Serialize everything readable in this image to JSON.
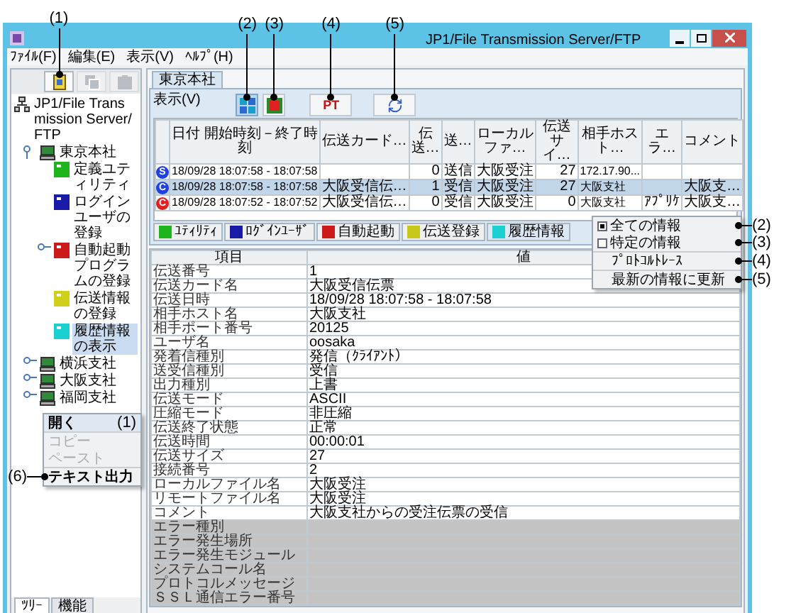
{
  "window": {
    "title": "JP1/File Transmission Server/FTP"
  },
  "menu_bar": [
    "ﾌｧｲﾙ(F)",
    "編集(E)",
    "表示(V)",
    "ﾍﾙﾌﾟ(H)"
  ],
  "left_toolbar": [
    {
      "kind": "book",
      "disabled": false,
      "callout": "(1)"
    },
    {
      "kind": "copy",
      "disabled": true
    },
    {
      "kind": "paste",
      "disabled": true
    }
  ],
  "tree": {
    "label": "JP1/File Transmission Server/FTP",
    "kind": "root",
    "children": [
      {
        "label": "東京本社",
        "kind": "host",
        "expanded": true,
        "selected": false,
        "children": [
          {
            "label": "定義ユティリティ",
            "kind": "function",
            "color": "#1fb51f",
            "selected": false
          },
          {
            "label": "ログインユーザの登録",
            "kind": "function",
            "color": "#1a1aa8",
            "selected": false
          },
          {
            "label": "自動起動プログラムの登録",
            "kind": "function",
            "color": "#cc1a1a",
            "expanded": false,
            "selected": false
          },
          {
            "label": "伝送情報の登録",
            "kind": "function",
            "color": "#d0d01a",
            "selected": false
          },
          {
            "label": "履歴情報の表示",
            "kind": "function",
            "color": "#1ad0d0",
            "selected": true
          }
        ]
      },
      {
        "label": "横浜支社",
        "kind": "host",
        "expanded": false,
        "selected": false
      },
      {
        "label": "大阪支社",
        "kind": "host",
        "expanded": false,
        "selected": false
      },
      {
        "label": "福岡支社",
        "kind": "host",
        "expanded": false,
        "selected": false
      }
    ]
  },
  "tree_menu": [
    {
      "label": "開く",
      "disabled": false,
      "callout": "(1)"
    },
    {
      "label": "コピー",
      "disabled": true
    },
    {
      "label": "ペースト",
      "disabled": true
    },
    {
      "label": "テキスト出力",
      "disabled": false,
      "callout": "(6)"
    }
  ],
  "left_tabs": [
    {
      "label": "ﾂﾘｰ",
      "selected": true
    },
    {
      "label": "機能",
      "selected": false
    }
  ],
  "host_tab": {
    "label": "東京本社",
    "selected": true
  },
  "view_menu_label": "表示(V)",
  "toolbar": [
    {
      "kind": "all",
      "selected": true,
      "callout": "(2)"
    },
    {
      "kind": "filter",
      "selected": false,
      "callout": "(3)"
    },
    {
      "kind": "trace",
      "label": "PT",
      "callout": "(4)"
    },
    {
      "kind": "refresh",
      "callout": "(5)"
    }
  ],
  "history_table": {
    "columns": [
      "日付 開始時刻－終了時刻",
      "伝送カード…",
      "伝送…",
      "送…",
      "ローカルファ…",
      "伝送サイ…",
      "相手ホスト…",
      "エラ…",
      "コメント"
    ],
    "rows": [
      {
        "status": "S",
        "color": "#2040e0",
        "selected": false,
        "cells": [
          "18/09/28 18:07:58 - 18:07:58",
          null,
          "0",
          "送信",
          "大阪受注",
          "27",
          "172.17.90...",
          null,
          null
        ]
      },
      {
        "status": "C",
        "color": "#2040e0",
        "selected": true,
        "cells": [
          "18/09/28 18:07:58 - 18:07:58",
          "大阪受信伝…",
          "1",
          "受信",
          "大阪受注",
          "27",
          "大阪支社",
          null,
          "大阪支…"
        ]
      },
      {
        "status": "C",
        "color": "#e02020",
        "selected": false,
        "cells": [
          "18/09/28 18:07:52 - 18:07:52",
          "大阪受信伝…",
          "0",
          "受信",
          "大阪受注",
          "0",
          "大阪支社",
          "ｱﾌﾟﾘｹ",
          "大阪支…"
        ]
      }
    ]
  },
  "view_menu": [
    {
      "label": "全ての情報",
      "kind": "check",
      "checked": true,
      "callout": "(2)"
    },
    {
      "label": "特定の情報",
      "kind": "check",
      "checked": false,
      "callout": "(3)"
    },
    {
      "label": "ﾌﾟﾛﾄｺﾙﾄﾚｰｽ",
      "kind": "command",
      "callout": "(4)"
    },
    {
      "label": "最新の情報に更新",
      "kind": "command",
      "callout": "(5)"
    }
  ],
  "function_tabs": [
    {
      "label": "ﾕﾃｨﾘﾃｨ",
      "color": "#1fb51f",
      "selected": false
    },
    {
      "label": "ﾛｸﾞｲﾝﾕｰｻﾞ",
      "color": "#1a1aa8",
      "selected": false
    },
    {
      "label": "自動起動",
      "color": "#cc1a1a",
      "selected": false
    },
    {
      "label": "伝送登録",
      "color": "#c8c81a",
      "selected": false
    },
    {
      "label": "履歴情報",
      "color": "#1ad0d0",
      "selected": true
    }
  ],
  "detail_table": {
    "columns": [
      "項目",
      "値"
    ],
    "rows": [
      {
        "item": "伝送番号",
        "value": "1",
        "disabled": false
      },
      {
        "item": "伝送カード名",
        "value": "大阪受信伝票",
        "disabled": false
      },
      {
        "item": "伝送日時",
        "value": "18/09/28 18:07:58 - 18:07:58",
        "disabled": false
      },
      {
        "item": "相手ホスト名",
        "value": "大阪支社",
        "disabled": false
      },
      {
        "item": "相手ポート番号",
        "value": "20125",
        "disabled": false
      },
      {
        "item": "ユーザ名",
        "value": "oosaka",
        "disabled": false
      },
      {
        "item": "発着信種別",
        "value": "発信（ｸﾗｲｱﾝﾄ）",
        "disabled": false
      },
      {
        "item": "送受信種別",
        "value": "受信",
        "disabled": false
      },
      {
        "item": "出力種別",
        "value": "上書",
        "disabled": false
      },
      {
        "item": "伝送モード",
        "value": "ASCII",
        "disabled": false
      },
      {
        "item": "圧縮モード",
        "value": "非圧縮",
        "disabled": false
      },
      {
        "item": "伝送終了状態",
        "value": "正常",
        "disabled": false
      },
      {
        "item": "伝送時間",
        "value": "00:00:01",
        "disabled": false
      },
      {
        "item": "伝送サイズ",
        "value": "27",
        "disabled": false
      },
      {
        "item": "接続番号",
        "value": "2",
        "disabled": false
      },
      {
        "item": "ローカルファイル名",
        "value": "大阪受注",
        "disabled": false
      },
      {
        "item": "リモートファイル名",
        "value": "大阪受注",
        "disabled": false
      },
      {
        "item": "コメント",
        "value": "大阪支社からの受注伝票の受信",
        "disabled": false
      },
      {
        "item": "エラー種別",
        "disabled": true
      },
      {
        "item": "エラー発生場所",
        "disabled": true
      },
      {
        "item": "エラー発生モジュール",
        "disabled": true
      },
      {
        "item": "システムコール名",
        "disabled": true
      },
      {
        "item": "プロトコルメッセージ",
        "disabled": true
      },
      {
        "item": "ＳＳＬ通信エラー番号",
        "disabled": true
      }
    ]
  }
}
